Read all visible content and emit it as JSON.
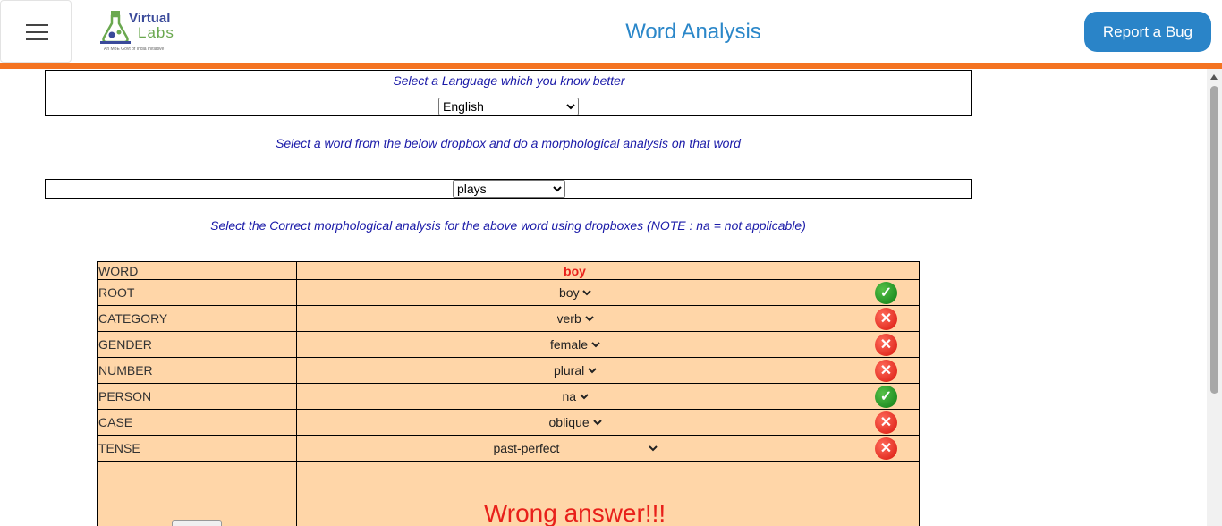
{
  "header": {
    "logo_virtual": "Virtual",
    "logo_labs": "Labs",
    "logo_tagline": "An MoE Govt of India Initiative",
    "title": "Word Analysis",
    "report_bug": "Report a Bug"
  },
  "colors": {
    "accent_orange": "#f47321",
    "title_blue": "#2b87c9",
    "button_blue": "#2a84c8",
    "table_bg": "#ffd6a8",
    "error_red": "#e8201a"
  },
  "language": {
    "label": "Select a Language which you know better",
    "selected": "English"
  },
  "word_select": {
    "instruction": "Select a word from the below dropbox and do a morphological analysis on that word",
    "selected": "plays"
  },
  "analysis": {
    "instruction": "Select the Correct morphological analysis for the above word using dropboxes (NOTE : na = not applicable)",
    "word_label": "WORD",
    "word_value": "boy",
    "rows": [
      {
        "label": "ROOT",
        "value": "boy",
        "result": "check-icon"
      },
      {
        "label": "CATEGORY",
        "value": "verb",
        "result": "cross-icon"
      },
      {
        "label": "GENDER",
        "value": "female",
        "result": "cross-icon"
      },
      {
        "label": "NUMBER",
        "value": "plural",
        "result": "cross-icon"
      },
      {
        "label": "PERSON",
        "value": "na",
        "result": "check-icon"
      },
      {
        "label": "CASE",
        "value": "oblique",
        "result": "cross-icon"
      },
      {
        "label": "TENSE",
        "value": "past-perfect",
        "result": "cross-icon"
      }
    ],
    "feedback": "Wrong answer!!!"
  }
}
